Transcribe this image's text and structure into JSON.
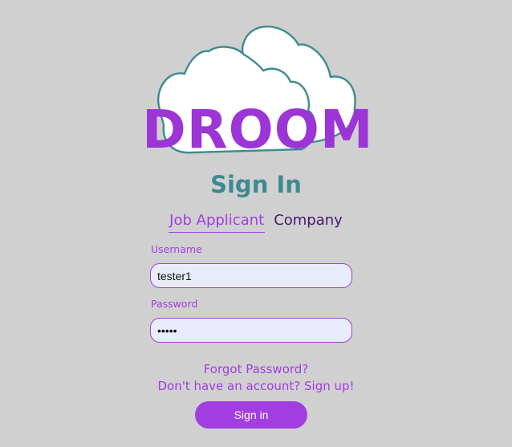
{
  "logo": {
    "text": "DROOM",
    "icon": "cloud-icon",
    "colors": {
      "cloud_outline": "#3e8a92",
      "cloud_fill": "#ffffff",
      "text": "#9c34d6"
    }
  },
  "header": {
    "title": "Sign In"
  },
  "tabs": [
    {
      "label": "Job Applicant",
      "active": true
    },
    {
      "label": "Company",
      "active": false
    }
  ],
  "form": {
    "username": {
      "label": "Username",
      "value": "tester1"
    },
    "password": {
      "label": "Password",
      "value": "•••••"
    }
  },
  "links": {
    "forgot_password": "Forgot Password?",
    "signup": "Don't have an account? Sign up!"
  },
  "buttons": {
    "signin": "Sign in"
  },
  "colors": {
    "background": "#d0d0d0",
    "accent": "#a23ee0",
    "title": "#3e8a92",
    "input_bg": "#e8edfb"
  }
}
